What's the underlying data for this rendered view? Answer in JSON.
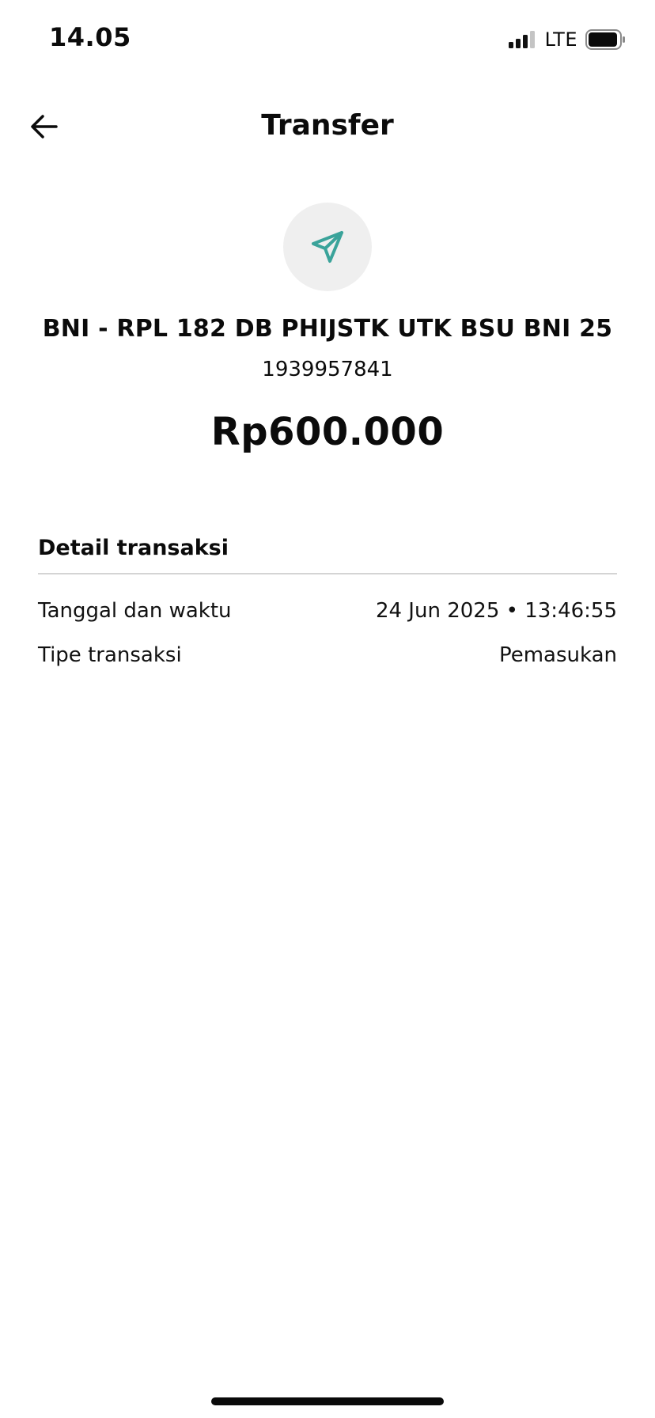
{
  "status_bar": {
    "time": "14.05",
    "network": "LTE"
  },
  "header": {
    "title": "Transfer",
    "back_icon": "arrow-left-icon"
  },
  "transaction": {
    "icon": "paper-plane-icon",
    "icon_color": "#3aa39a",
    "recipient_name": "BNI - RPL 182 DB PHIJSTK UTK BSU BNI 25",
    "account_number": "1939957841",
    "amount": "Rp600.000"
  },
  "details": {
    "title": "Detail transaksi",
    "rows": [
      {
        "label": "Tanggal dan waktu",
        "value": "24 Jun 2025 • 13:46:55"
      },
      {
        "label": "Tipe transaksi",
        "value": "Pemasukan"
      }
    ]
  }
}
